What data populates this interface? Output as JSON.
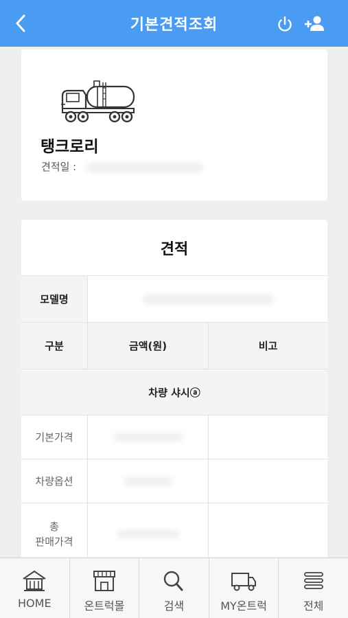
{
  "header": {
    "title": "기본견적조회",
    "back_icon": "chevron-left-icon",
    "power_icon": "power-icon",
    "add_user_icon": "add-user-icon"
  },
  "vehicle": {
    "image_icon": "tank-lorry-icon",
    "name": "탱크로리",
    "date_label": "견적일 :"
  },
  "quote": {
    "title": "견적",
    "model_label": "모델명",
    "headers": [
      "구분",
      "금액(원)",
      "비고"
    ],
    "section": "차량 샤시ⓐ",
    "rows": [
      {
        "label": "기본가격"
      },
      {
        "label": "차량옵션"
      },
      {
        "label": "총\n판매가격"
      }
    ]
  },
  "bottom_nav": [
    {
      "label": "HOME",
      "icon": "home-icon"
    },
    {
      "label": "온트럭몰",
      "icon": "store-icon"
    },
    {
      "label": "검색",
      "icon": "search-icon"
    },
    {
      "label": "MY온트럭",
      "icon": "truck-icon"
    },
    {
      "label": "전체",
      "icon": "menu-icon"
    }
  ],
  "colors": {
    "header_bg": "#4a9cf2",
    "page_bg": "#efefef"
  }
}
